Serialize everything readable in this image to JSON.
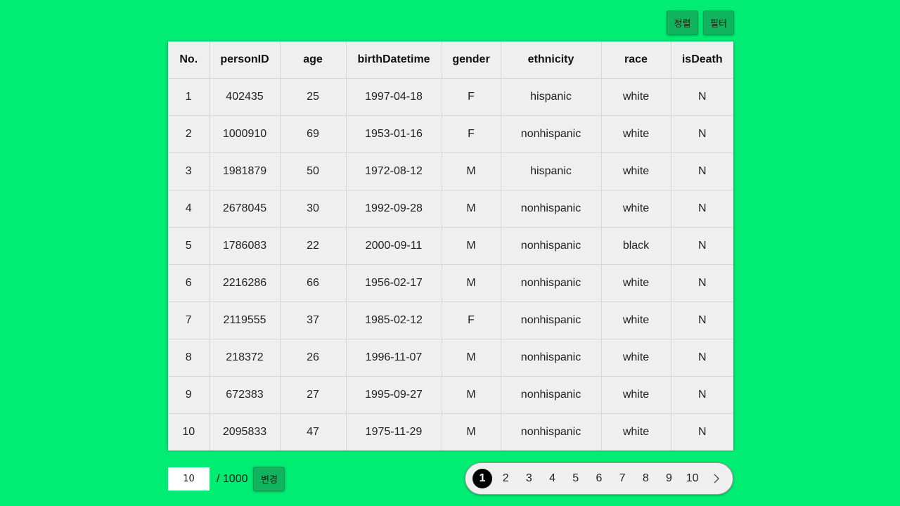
{
  "toolbar": {
    "sort_label": "정렬",
    "filter_label": "필터"
  },
  "table": {
    "columns": [
      "No.",
      "personID",
      "age",
      "birthDatetime",
      "gender",
      "ethnicity",
      "race",
      "isDeath"
    ],
    "rows": [
      [
        "1",
        "402435",
        "25",
        "1997-04-18",
        "F",
        "hispanic",
        "white",
        "N"
      ],
      [
        "2",
        "1000910",
        "69",
        "1953-01-16",
        "F",
        "nonhispanic",
        "white",
        "N"
      ],
      [
        "3",
        "1981879",
        "50",
        "1972-08-12",
        "M",
        "hispanic",
        "white",
        "N"
      ],
      [
        "4",
        "2678045",
        "30",
        "1992-09-28",
        "M",
        "nonhispanic",
        "white",
        "N"
      ],
      [
        "5",
        "1786083",
        "22",
        "2000-09-11",
        "M",
        "nonhispanic",
        "black",
        "N"
      ],
      [
        "6",
        "2216286",
        "66",
        "1956-02-17",
        "M",
        "nonhispanic",
        "white",
        "N"
      ],
      [
        "7",
        "2119555",
        "37",
        "1985-02-12",
        "F",
        "nonhispanic",
        "white",
        "N"
      ],
      [
        "8",
        "218372",
        "26",
        "1996-11-07",
        "M",
        "nonhispanic",
        "white",
        "N"
      ],
      [
        "9",
        "672383",
        "27",
        "1995-09-27",
        "M",
        "nonhispanic",
        "white",
        "N"
      ],
      [
        "10",
        "2095833",
        "47",
        "1975-11-29",
        "M",
        "nonhispanic",
        "white",
        "N"
      ]
    ]
  },
  "page_size": {
    "value": "10",
    "total_label": "/ 1000",
    "change_label": "변경"
  },
  "pagination": {
    "pages": [
      "1",
      "2",
      "3",
      "4",
      "5",
      "6",
      "7",
      "8",
      "9",
      "10"
    ],
    "current": "1",
    "next_icon": "chevron-right-icon"
  },
  "colors": {
    "background": "#00ec72",
    "button": "#10b35e",
    "table_background": "#efefef",
    "active_page": "#000000"
  }
}
